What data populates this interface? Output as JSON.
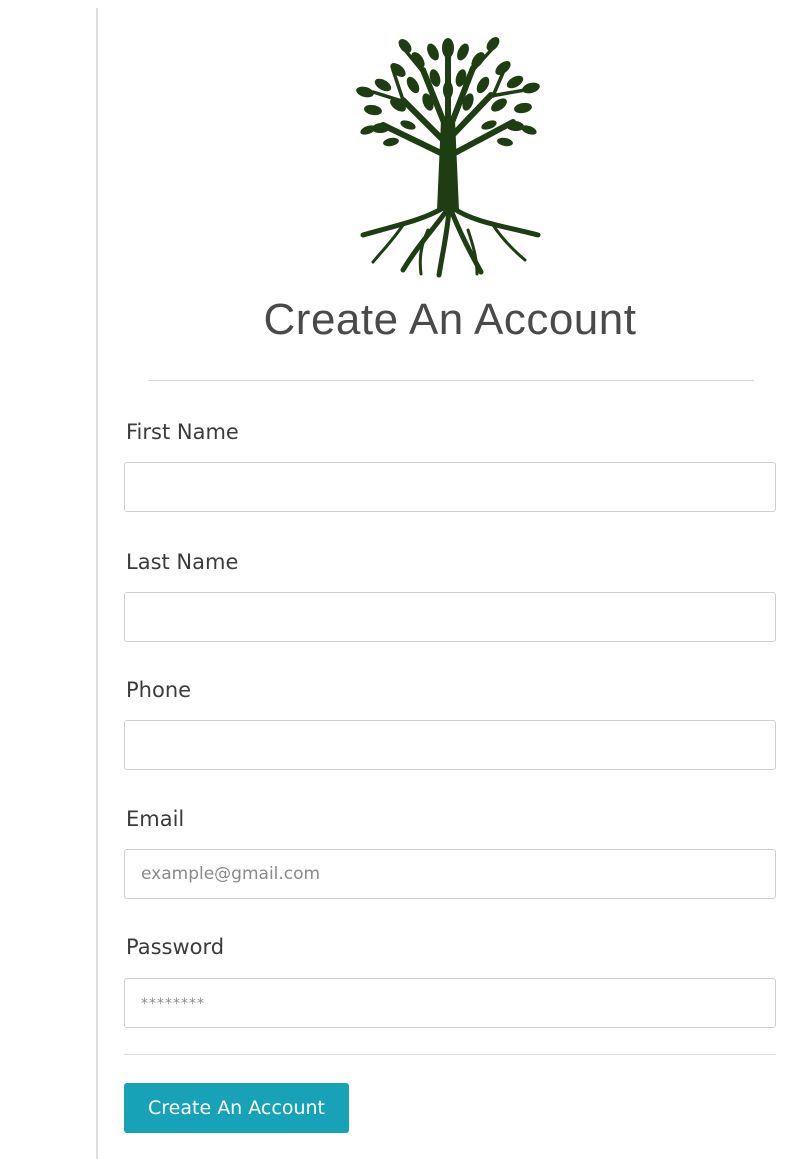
{
  "page": {
    "title": "Create An Account",
    "logo_icon": "tree-logo-icon",
    "accent_color": "#17a2b8",
    "logo_color": "#1e3d12"
  },
  "form": {
    "first_name": {
      "label": "First Name",
      "value": "",
      "placeholder": ""
    },
    "last_name": {
      "label": "Last Name",
      "value": "",
      "placeholder": ""
    },
    "phone": {
      "label": "Phone",
      "value": "",
      "placeholder": ""
    },
    "email": {
      "label": "Email",
      "value": "",
      "placeholder": "example@gmail.com"
    },
    "password": {
      "label": "Password",
      "value": "",
      "placeholder": "********"
    },
    "submit_label": "Create An Account"
  }
}
